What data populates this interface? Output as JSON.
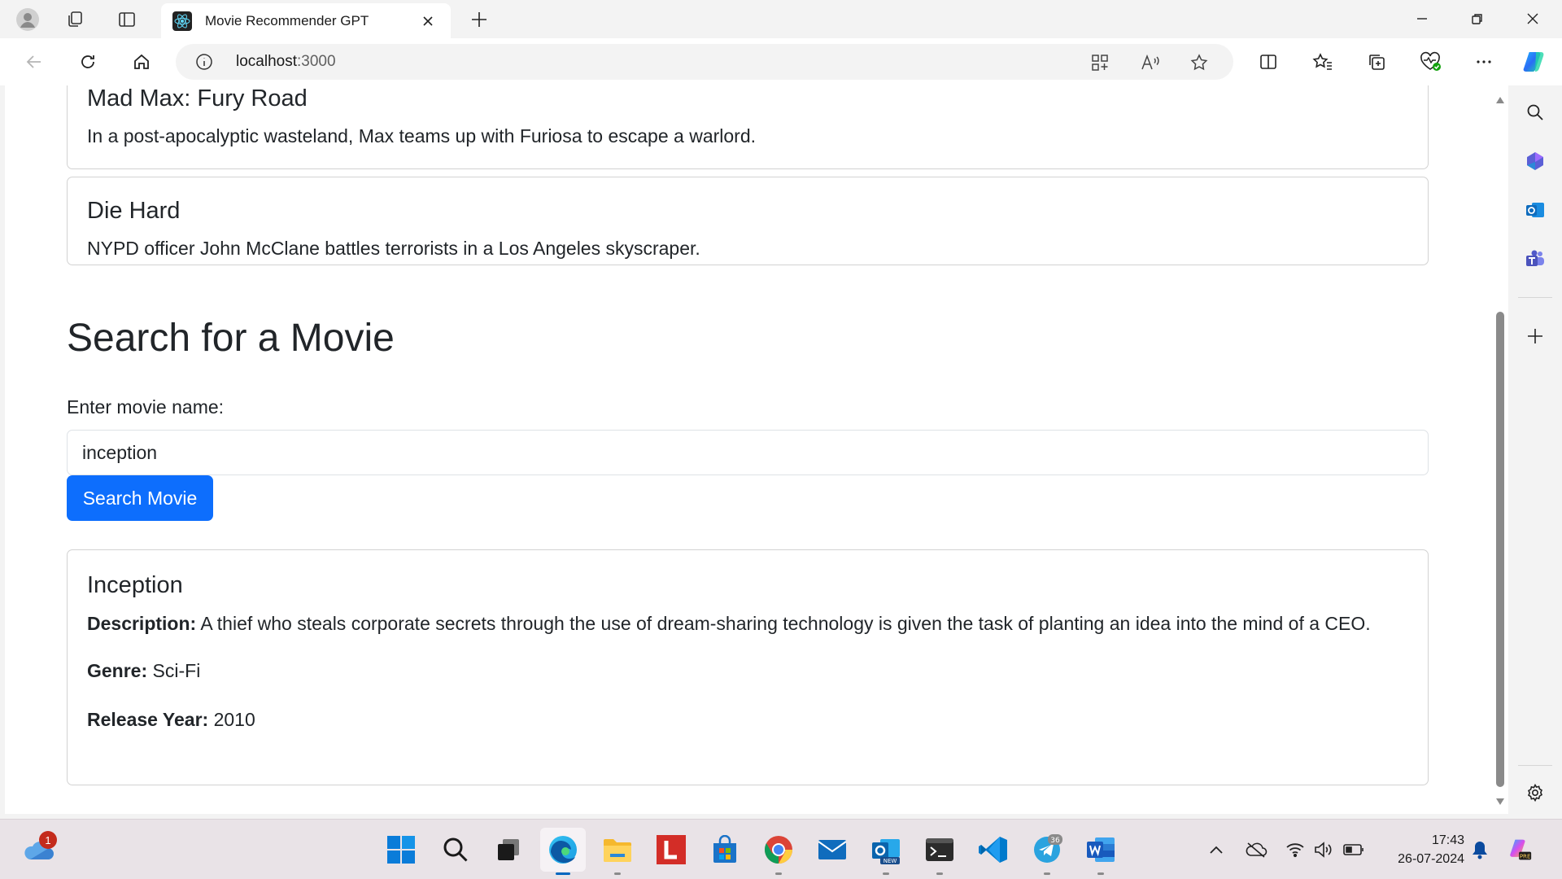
{
  "browser": {
    "tab_title": "Movie Recommender GPT",
    "address": "localhost",
    "address_port": ":3000"
  },
  "page": {
    "cards": [
      {
        "title": "Mad Max: Fury Road",
        "description": "In a post-apocalyptic wasteland, Max teams up with Furiosa to escape a warlord."
      },
      {
        "title": "Die Hard",
        "description": "NYPD officer John McClane battles terrorists in a Los Angeles skyscraper."
      }
    ],
    "search": {
      "heading": "Search for a Movie",
      "label": "Enter movie name:",
      "value": "inception",
      "button": "Search Movie"
    },
    "result": {
      "title": "Inception",
      "description_label": "Description:",
      "description": "A thief who steals corporate secrets through the use of dream-sharing technology is given the task of planting an idea into the mind of a CEO.",
      "genre_label": "Genre:",
      "genre": "Sci-Fi",
      "year_label": "Release Year:",
      "year": "2010"
    }
  },
  "taskbar": {
    "weather_badge": "1",
    "telegram_badge": "36",
    "time": "17:43",
    "date": "26-07-2024"
  },
  "colors": {
    "primary_button": "#0d6efd",
    "card_border": "#d9d9d9"
  }
}
